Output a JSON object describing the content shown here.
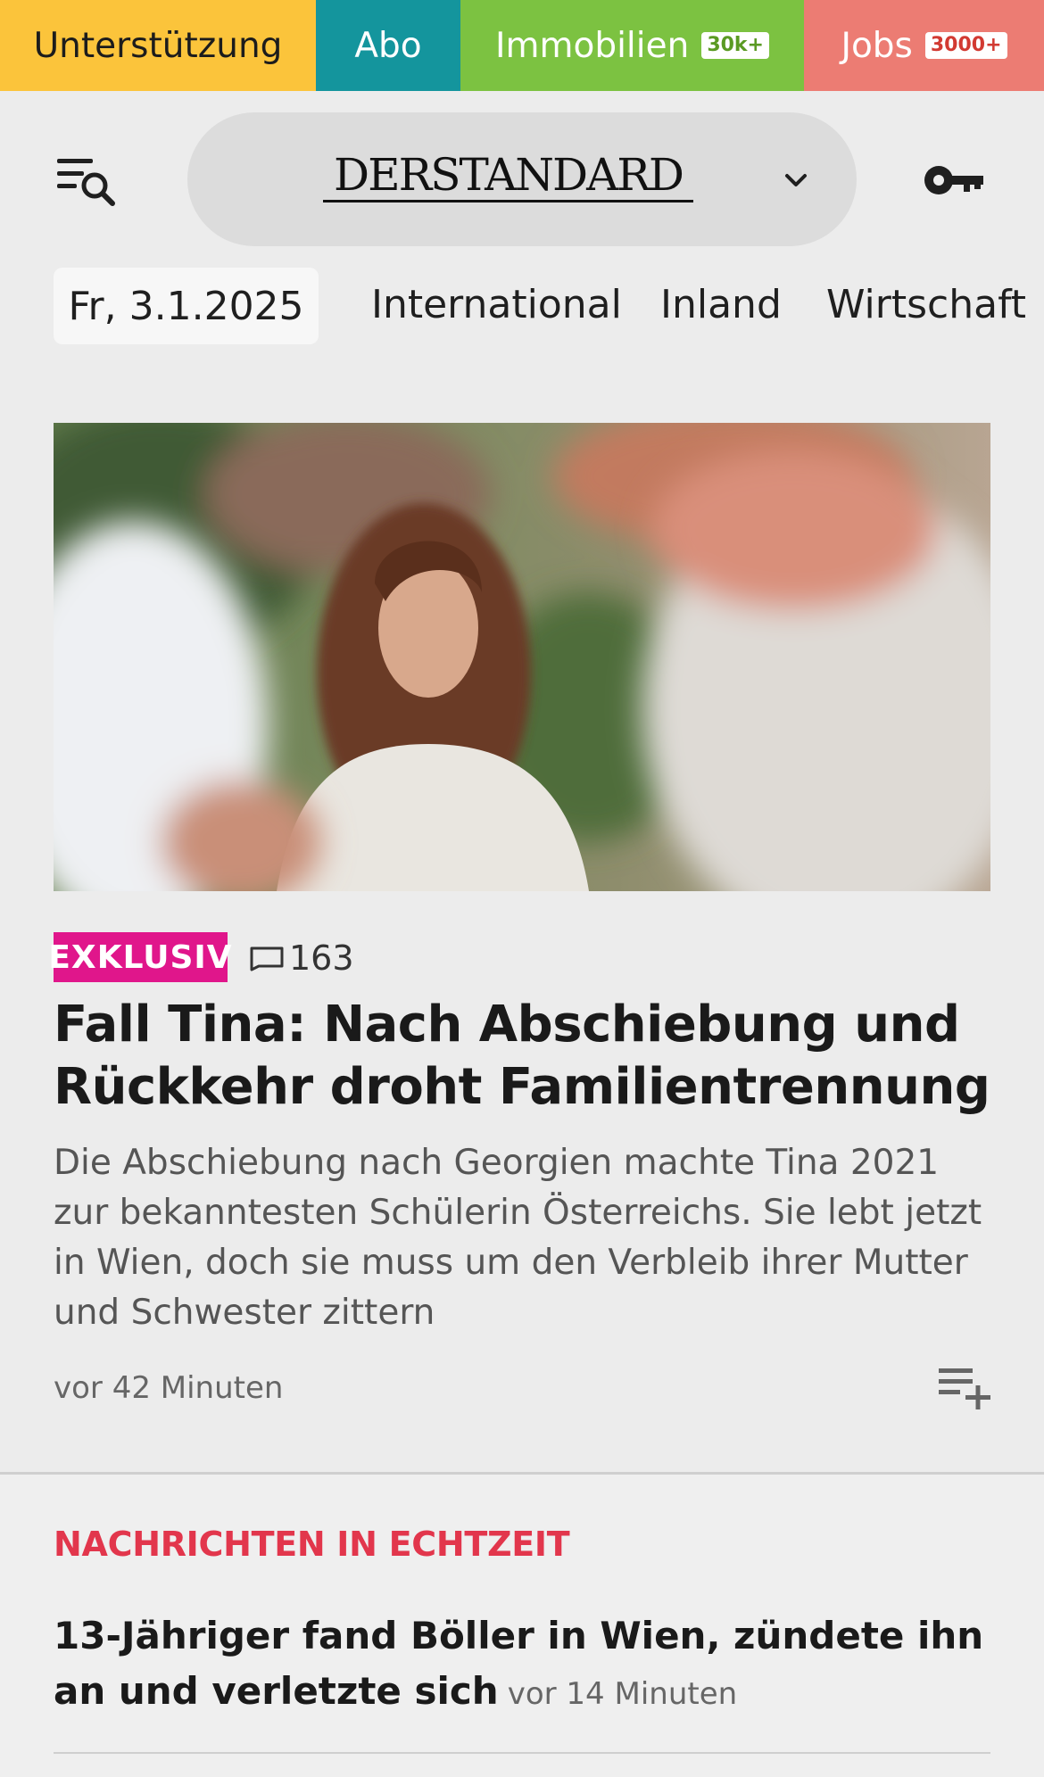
{
  "topbar": {
    "support_label": "Unterstützung",
    "abo_label": "Abo",
    "immobilien_label": "Immobilien",
    "immobilien_badge": "30k+",
    "jobs_label": "Jobs",
    "jobs_badge": "3000+"
  },
  "header": {
    "logo_text": "DERSTANDARD"
  },
  "nav": {
    "date": "Fr, 3.1.2025",
    "items": [
      "International",
      "Inland",
      "Wirtschaft"
    ]
  },
  "article": {
    "tag": "EXKLUSIV",
    "comment_count": "163",
    "headline": "Fall Tina: Nach Abschiebung und Rückkehr droht Familientrennung",
    "teaser": "Die Abschiebung nach Georgien machte Tina 2021 zur bekanntesten Schülerin Österreichs. Sie lebt jetzt in Wien, doch sie muss um den Verbleib ihrer Mutter und Schwester zittern",
    "timestamp": "vor 42 Minuten"
  },
  "live": {
    "heading": "NACHRICHTEN IN ECHTZEIT",
    "items": [
      {
        "title": "13-Jähriger fand Böller in Wien, zündete ihn an und verletzte sich",
        "time": "vor 14 Minuten"
      }
    ]
  },
  "colors": {
    "support": "#fbc43b",
    "abo": "#14959d",
    "immobilien": "#7cc241",
    "jobs": "#ec7c73",
    "exklusiv": "#e0168b",
    "live_heading": "#e2364c"
  }
}
